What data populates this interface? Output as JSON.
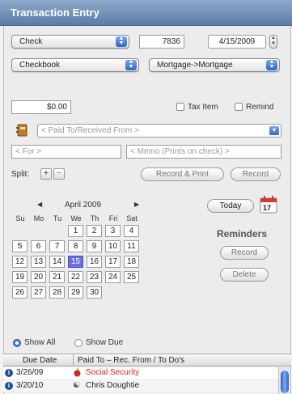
{
  "window": {
    "title": "Transaction Entry"
  },
  "entry": {
    "type_popup": "Check",
    "check_number": "7836",
    "date": "4/15/2009",
    "account_popup": "Checkbook",
    "category_popup": "Mortgage->Mortgage",
    "amount": "$0.00",
    "tax_item_label": "Tax Item",
    "remind_label": "Remind",
    "payee_placeholder": "< Paid To/Received From >",
    "for_placeholder": "< For >",
    "memo_placeholder": "< Memo (Prints on check) >",
    "split_label": "Split:",
    "split_add": "+",
    "split_remove": "−",
    "record_print_label": "Record & Print",
    "record_label": "Record"
  },
  "calendar": {
    "prev": "◀",
    "next": "▶",
    "month_year": "April 2009",
    "weekdays": [
      "Su",
      "Mo",
      "Tu",
      "We",
      "Th",
      "Fri",
      "Sat"
    ],
    "days": [
      "1",
      "2",
      "3",
      "4",
      "5",
      "6",
      "7",
      "8",
      "9",
      "10",
      "11",
      "12",
      "13",
      "14",
      "15",
      "16",
      "17",
      "18",
      "19",
      "20",
      "21",
      "22",
      "23",
      "24",
      "25",
      "26",
      "27",
      "28",
      "29",
      "30"
    ],
    "selected_day": "15",
    "today_label": "Today",
    "calendar_icon_num": "17"
  },
  "reminders": {
    "title": "Reminders",
    "record_label": "Record",
    "delete_label": "Delete"
  },
  "filter": {
    "show_all": "Show All",
    "show_due": "Show Due"
  },
  "table": {
    "headers": [
      "Due Date",
      "Paid To – Rec. From / To Do's"
    ],
    "rows": [
      {
        "date": "3/26/09",
        "payee": "Social Security",
        "color": "#e02020"
      },
      {
        "date": "3/20/10",
        "payee": "Chris Doughtie",
        "color": "#222222"
      }
    ]
  }
}
